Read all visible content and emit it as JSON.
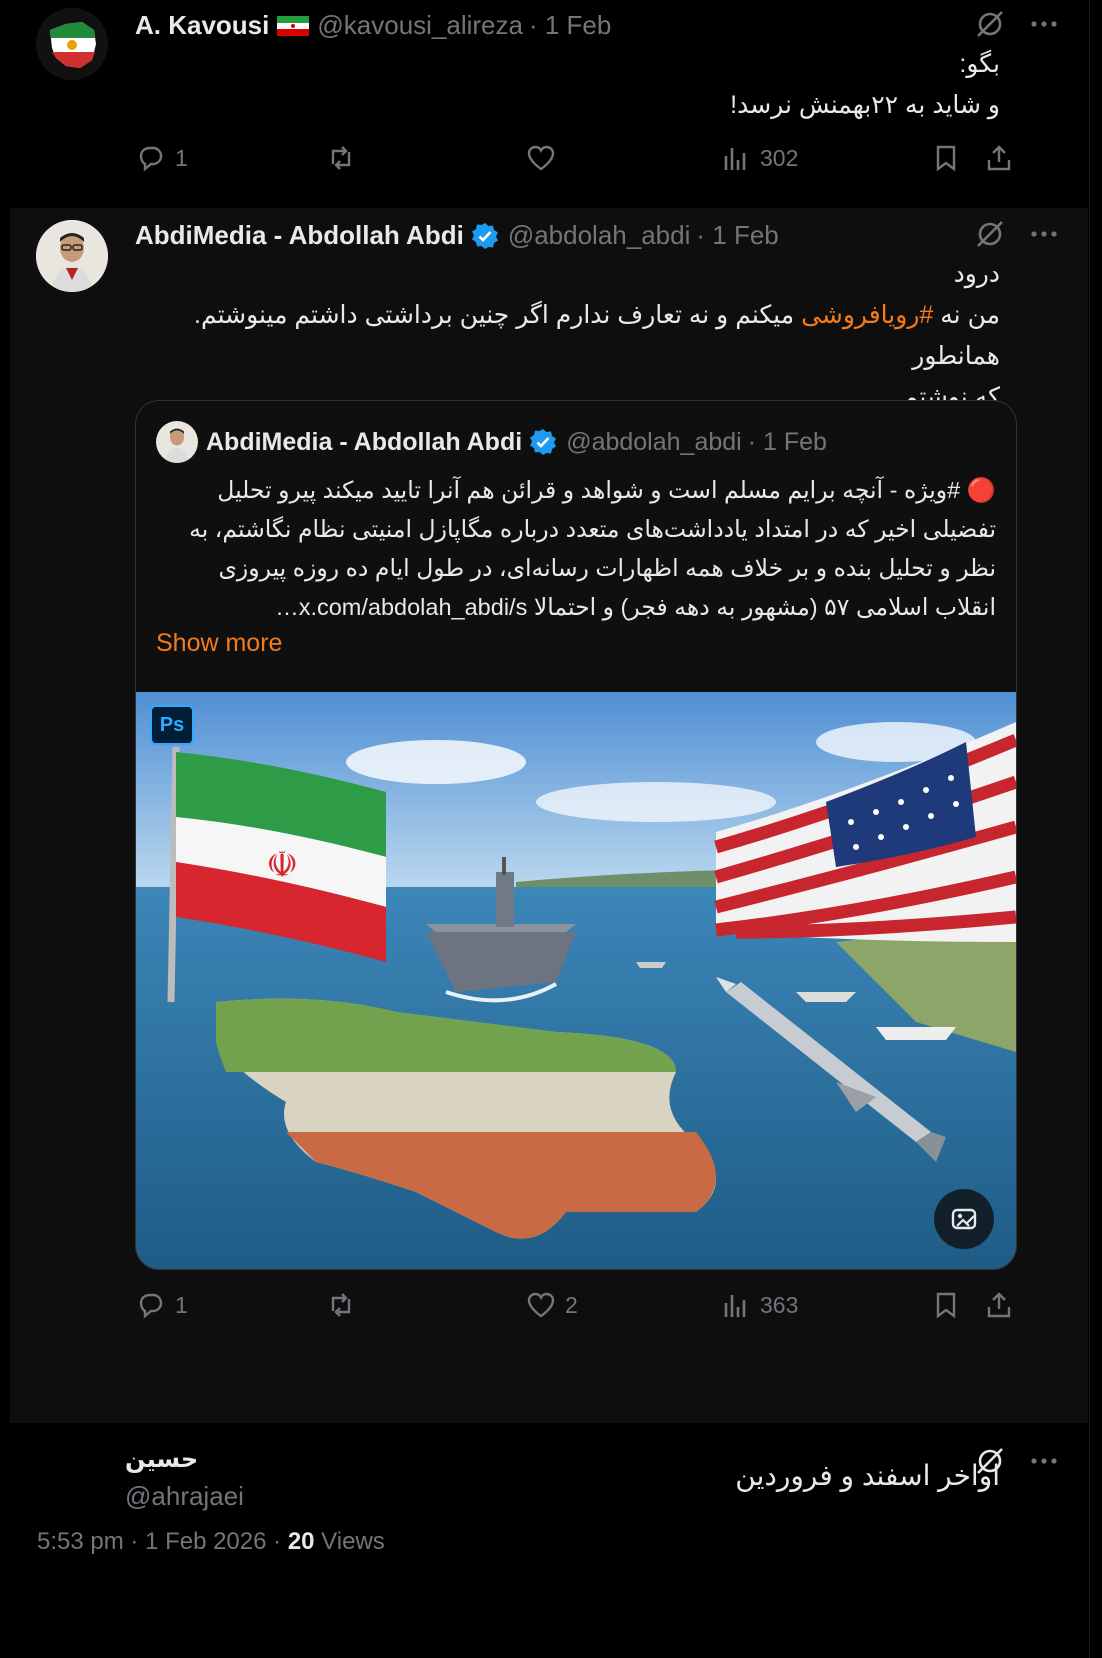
{
  "tweet1": {
    "author_name": "A. Kavousi",
    "handle": "@kavousi_alireza",
    "date": "· 1 Feb",
    "text_line1": "بگو:",
    "text_line2": "و شاید به ۲۲بهمنش نرسد!",
    "replies": "1",
    "views": "302"
  },
  "tweet2": {
    "author_name": "AbdiMedia - Abdollah Abdi",
    "handle": "@abdolah_abdi",
    "date": "· 1 Feb",
    "text_line1": "درود",
    "text_line2_pre": "من نه ",
    "text_hashtag": "#رویافروشی",
    "text_line2_post": " میکنم و نه تعارف ندارم اگر چنین برداشتی داشتم مینوشتم. همانطور",
    "text_line3": "که نوشتم",
    "quote": {
      "author_name": "AbdiMedia - Abdollah Abdi",
      "handle": "@abdolah_abdi",
      "date": "· 1 Feb",
      "line1": "🔴 #ویژه - آنچه برایم مسلم است و شواهد و قرائن هم آنرا تایید میکند پیرو تحلیل",
      "line2": "تفضیلی اخیر که در امتداد یادداشت‌های متعدد درباره مگاپازل امنیتی نظام نگاشتم، به",
      "line3": "نظر و تحلیل بنده و بر خلاف همه اظهارات رسانه‌ای، در طول ایام ده روزه پیروزی",
      "line4": "انقلاب اسلامی ۵۷ (مشهور به دهه فجر) و احتمالا  x.com/abdolah_abdi/s…",
      "show_more": "Show more",
      "image_badge": "Ps"
    },
    "replies": "1",
    "likes": "2",
    "views": "363"
  },
  "tweet3": {
    "author_name": "حسین",
    "handle": "@ahrajaei",
    "text": "اواخر اسفند و فروردین",
    "time": "5:53 pm · 1 Feb 2026 · ",
    "views_count": "20",
    "views_label": " Views"
  },
  "colors": {
    "background": "#000000",
    "text": "#e7e9ea",
    "muted": "#71767b",
    "accent": "#f27b1c",
    "verified": "#1d9bf0"
  },
  "icons": [
    "grok-icon",
    "more-icon",
    "reply-icon",
    "retweet-icon",
    "like-icon",
    "views-icon",
    "bookmark-icon",
    "share-icon",
    "verified-icon",
    "edit-image-icon"
  ]
}
